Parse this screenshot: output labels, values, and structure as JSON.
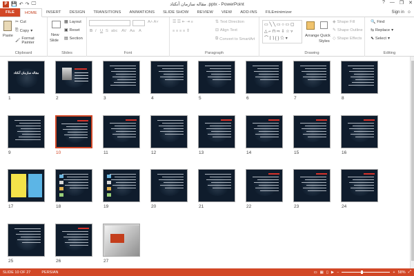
{
  "window": {
    "title": "مقاله سازمان آنکتاد .pptx - PowerPoint",
    "help": "?",
    "minimize": "—",
    "restore": "❐",
    "close": "✕"
  },
  "qat": {
    "save": "💾",
    "undo": "↶",
    "redo": "↷",
    "start": "🖵"
  },
  "tabs": [
    "FILE",
    "HOME",
    "INSERT",
    "DESIGN",
    "TRANSITIONS",
    "ANIMATIONS",
    "SLIDE SHOW",
    "REVIEW",
    "VIEW",
    "ADD-INS",
    "FILEminimizer"
  ],
  "active_tab": "HOME",
  "account": {
    "signin": "Sign in"
  },
  "ribbon": {
    "clipboard": {
      "paste": "Paste",
      "cut": "Cut",
      "copy": "Copy",
      "format_painter": "Format Painter",
      "label": "Clipboard"
    },
    "slides": {
      "new_slide": "New",
      "new_slide_2": "Slide",
      "layout": "Layout",
      "reset": "Reset",
      "section": "Section",
      "label": "Slides"
    },
    "font": {
      "label": "Font"
    },
    "paragraph": {
      "text_direction": "Text Direction",
      "align_text": "Align Text",
      "convert_smartart": "Convert to SmartArt",
      "label": "Paragraph"
    },
    "drawing": {
      "arrange": "Arrange",
      "quick_styles": "Quick",
      "quick_styles_2": "Styles",
      "shape_fill": "Shape Fill",
      "shape_outline": "Shape Outline",
      "shape_effects": "Shape Effects",
      "label": "Drawing"
    },
    "editing": {
      "find": "Find",
      "replace": "Replace",
      "select": "Select",
      "label": "Editing"
    }
  },
  "slides": [
    "1",
    "2",
    "3",
    "4",
    "5",
    "6",
    "7",
    "8",
    "9",
    "10",
    "11",
    "12",
    "13",
    "14",
    "15",
    "16",
    "17",
    "18",
    "19",
    "20",
    "21",
    "22",
    "23",
    "24",
    "25",
    "26",
    "27"
  ],
  "slide1_title": "مقاله سازمان آنکتاد",
  "selected_slide": "10",
  "status": {
    "slide_info": "SLIDE 10 OF 27",
    "language": "PERSIAN",
    "zoom": "58%"
  }
}
